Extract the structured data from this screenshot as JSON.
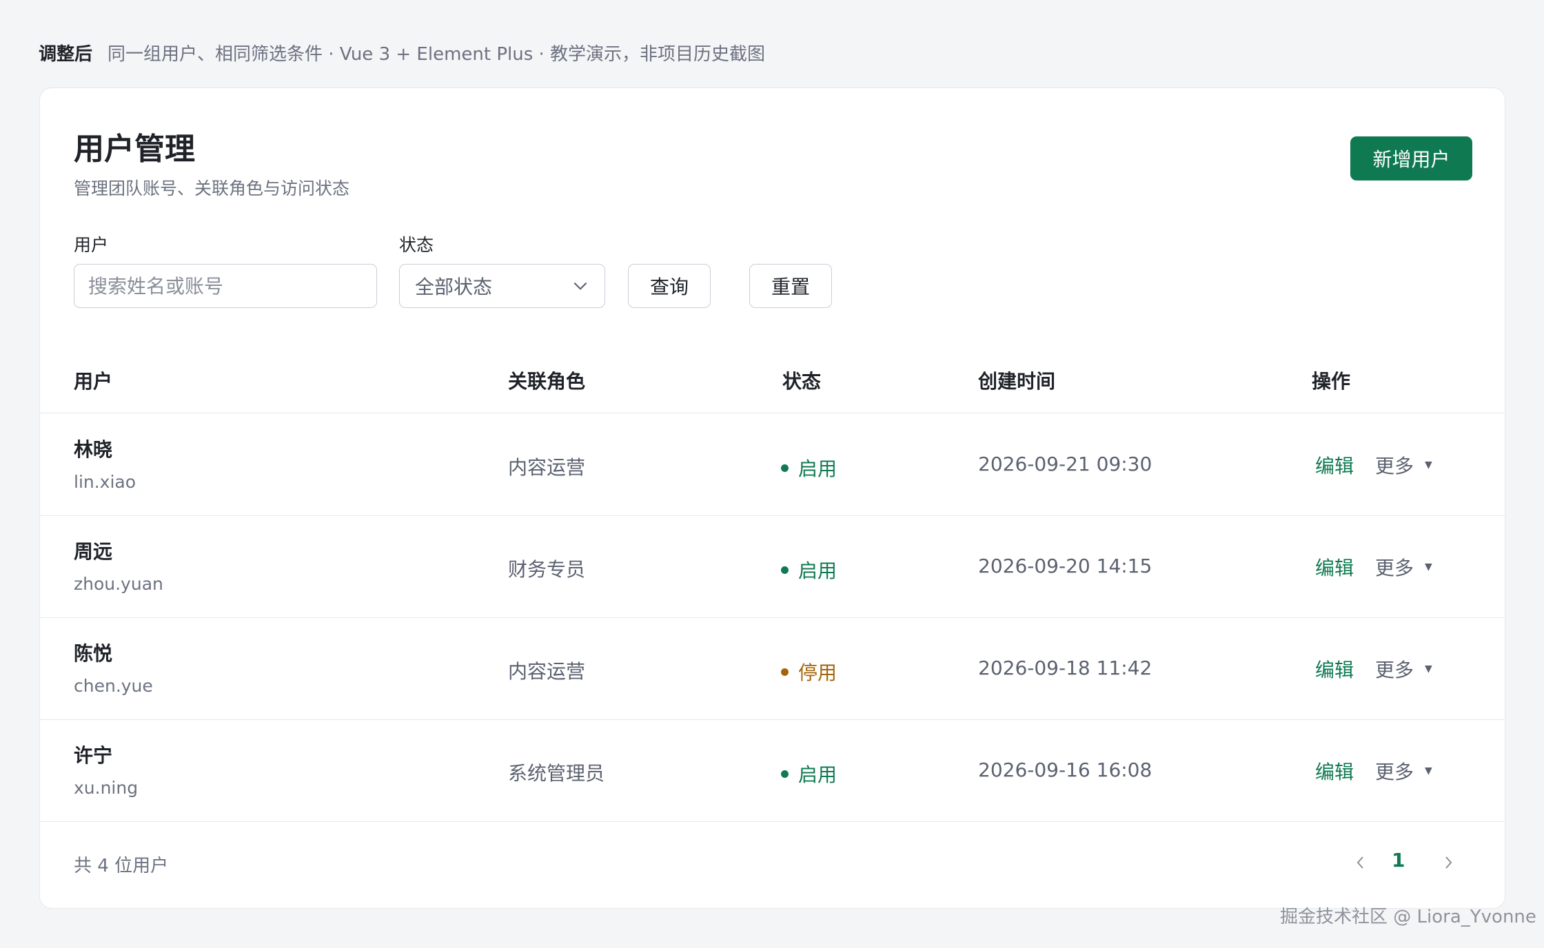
{
  "caption": {
    "label": "调整后",
    "text": "同一组用户、相同筛选条件 · Vue 3 + Element Plus · 教学演示，非项目历史截图"
  },
  "header": {
    "title": "用户管理",
    "subtitle": "管理团队账号、关联角色与访问状态",
    "add_button": "新增用户"
  },
  "filters": {
    "user_label": "用户",
    "user_placeholder": "搜索姓名或账号",
    "status_label": "状态",
    "status_value": "全部状态",
    "query_button": "查询",
    "reset_button": "重置"
  },
  "table": {
    "columns": [
      "用户",
      "关联角色",
      "状态",
      "创建时间",
      "操作"
    ],
    "rows": [
      {
        "name": "林晓",
        "account": "lin.xiao",
        "role": "内容运营",
        "status": "启用",
        "created": "2026-09-21 09:30",
        "edit": "编辑",
        "more": "更多"
      },
      {
        "name": "周远",
        "account": "zhou.yuan",
        "role": "财务专员",
        "status": "启用",
        "created": "2026-09-20 14:15",
        "edit": "编辑",
        "more": "更多"
      },
      {
        "name": "陈悦",
        "account": "chen.yue",
        "role": "内容运营",
        "status": "停用",
        "created": "2026-09-18 11:42",
        "edit": "编辑",
        "more": "更多"
      },
      {
        "name": "许宁",
        "account": "xu.ning",
        "role": "系统管理员",
        "status": "启用",
        "created": "2026-09-16 16:08",
        "edit": "编辑",
        "more": "更多"
      }
    ]
  },
  "pagination": {
    "total_text": "共 4 位用户",
    "current_page": "1"
  },
  "watermark": "掘金技术社区 @ Liora_Yvonne",
  "colors": {
    "accent": "#0f7a52",
    "status_on": "#0f7a52",
    "status_off": "#a3650b",
    "background": "#f4f5f7"
  },
  "icons": {
    "select_arrow": "chevron-down-icon",
    "more_caret": "caret-down-icon",
    "prev": "chevron-left-icon",
    "next": "chevron-right-icon"
  }
}
